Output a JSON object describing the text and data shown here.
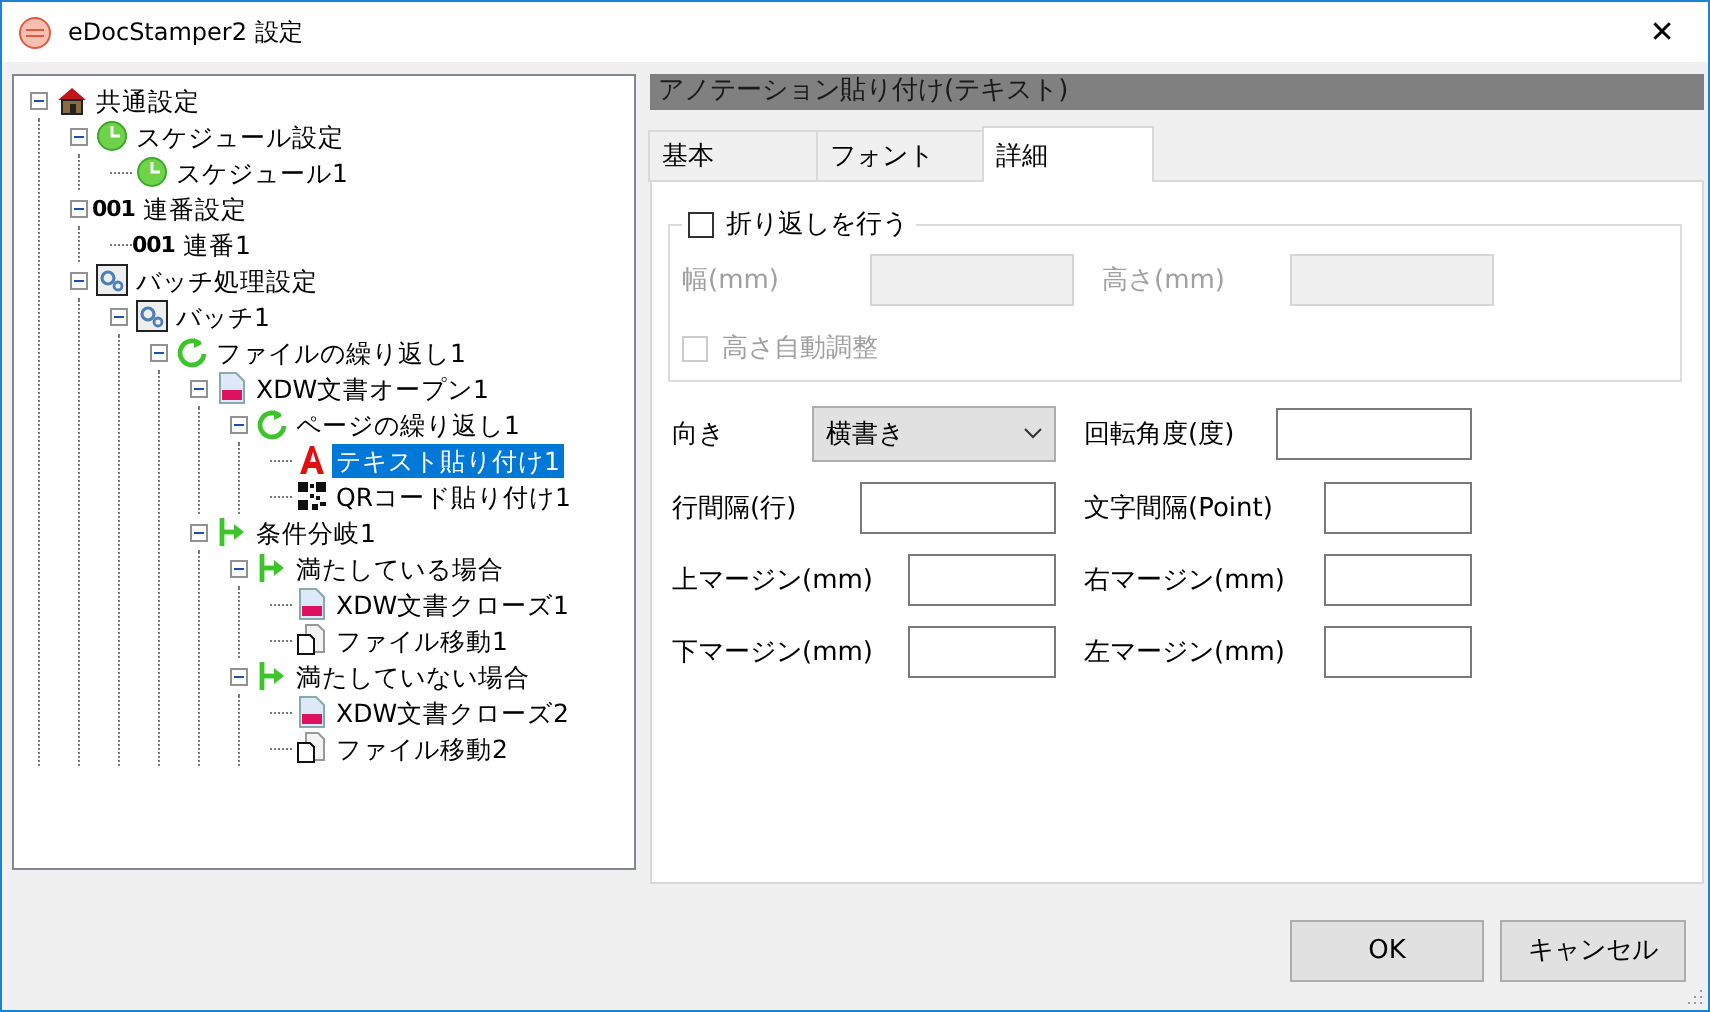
{
  "window": {
    "title": "eDocStamper2 設定",
    "close": "✕"
  },
  "tree": [
    {
      "label": "共通設定",
      "kind": "house",
      "expanded": true,
      "selected": false,
      "children": [
        {
          "label": "スケジュール設定",
          "kind": "clock",
          "expanded": true,
          "selected": false,
          "children": [
            {
              "label": "スケジュール1",
              "kind": "clock",
              "selected": false
            }
          ]
        },
        {
          "label": "連番設定",
          "kind": "number",
          "number": "001",
          "expanded": true,
          "selected": false,
          "children": [
            {
              "label": "連番1",
              "kind": "number",
              "number": "001",
              "selected": false
            }
          ]
        },
        {
          "label": "バッチ処理設定",
          "kind": "gear",
          "expanded": true,
          "selected": false,
          "children": [
            {
              "label": "バッチ1",
              "kind": "gear",
              "expanded": true,
              "selected": false,
              "children": [
                {
                  "label": "ファイルの繰り返し1",
                  "kind": "loop",
                  "expanded": true,
                  "selected": false,
                  "children": [
                    {
                      "label": "XDW文書オープン1",
                      "kind": "document",
                      "expanded": true,
                      "selected": false,
                      "children": [
                        {
                          "label": "ページの繰り返し1",
                          "kind": "loop",
                          "expanded": true,
                          "selected": false,
                          "children": [
                            {
                              "label": "テキスト貼り付け1",
                              "kind": "text",
                              "selected": true
                            },
                            {
                              "label": "QRコード貼り付け1",
                              "kind": "qr",
                              "selected": false
                            }
                          ]
                        }
                      ]
                    },
                    {
                      "label": "条件分岐1",
                      "kind": "branch",
                      "expanded": true,
                      "selected": false,
                      "children": [
                        {
                          "label": "満たしている場合",
                          "kind": "branch",
                          "expanded": true,
                          "selected": false,
                          "children": [
                            {
                              "label": "XDW文書クローズ1",
                              "kind": "document",
                              "selected": false
                            },
                            {
                              "label": "ファイル移動1",
                              "kind": "file",
                              "selected": false
                            }
                          ]
                        },
                        {
                          "label": "満たしていない場合",
                          "kind": "branch",
                          "expanded": true,
                          "selected": false,
                          "children": [
                            {
                              "label": "XDW文書クローズ2",
                              "kind": "document",
                              "selected": false
                            },
                            {
                              "label": "ファイル移動2",
                              "kind": "file",
                              "selected": false
                            }
                          ]
                        }
                      ]
                    }
                  ]
                }
              ]
            }
          ]
        }
      ]
    }
  ],
  "panel": {
    "header": "アノテーション貼り付け(テキスト)",
    "tabs": [
      {
        "label": "基本",
        "selected": false
      },
      {
        "label": "フォント",
        "selected": false
      },
      {
        "label": "詳細",
        "selected": true
      }
    ],
    "wrap_group": {
      "checkbox": {
        "label": "折り返しを行う",
        "checked": false
      },
      "fields": [
        {
          "label": "幅(mm)",
          "disabled": true
        },
        {
          "label": "高さ(mm)",
          "disabled": true
        }
      ],
      "auto_height": {
        "label": "高さ自動調整",
        "checked": false,
        "disabled": true
      }
    },
    "rows": [
      [
        {
          "label": "向き",
          "kind": "select",
          "value": "横書き"
        },
        {
          "label": "回転角度(度)",
          "kind": "input"
        }
      ],
      [
        {
          "label": "行間隔(行)",
          "kind": "input"
        },
        {
          "label": "文字間隔(Point)",
          "kind": "input"
        }
      ],
      [
        {
          "label": "上マージン(mm)",
          "kind": "input"
        },
        {
          "label": "右マージン(mm)",
          "kind": "input"
        }
      ],
      [
        {
          "label": "下マージン(mm)",
          "kind": "input"
        },
        {
          "label": "左マージン(mm)",
          "kind": "input"
        }
      ]
    ]
  },
  "buttons": [
    {
      "label": "OK"
    },
    {
      "label": "キャンセル"
    }
  ]
}
